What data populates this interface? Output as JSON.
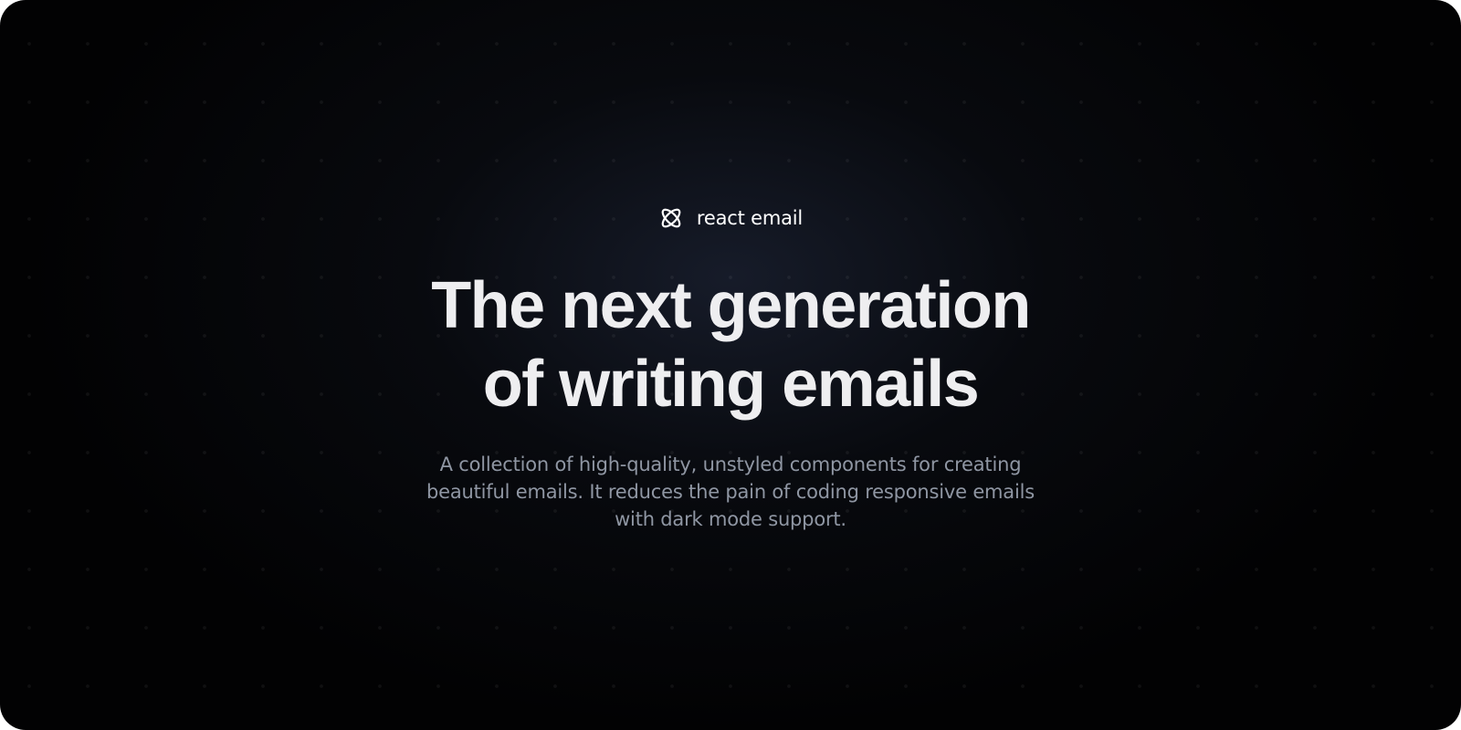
{
  "brand": {
    "icon": "atom-logo-icon",
    "name": "react email"
  },
  "hero": {
    "headline_lines": [
      "The next generation",
      "of writing emails"
    ],
    "description_lines": [
      "A collection of high-quality, unstyled components for creating",
      "beautiful emails. It reduces the pain of coding responsive emails",
      "with dark mode support."
    ]
  },
  "colors": {
    "background": "#020203",
    "headline": "#eeeef0",
    "description": "#8f96a3",
    "brand_text": "#ffffff"
  }
}
